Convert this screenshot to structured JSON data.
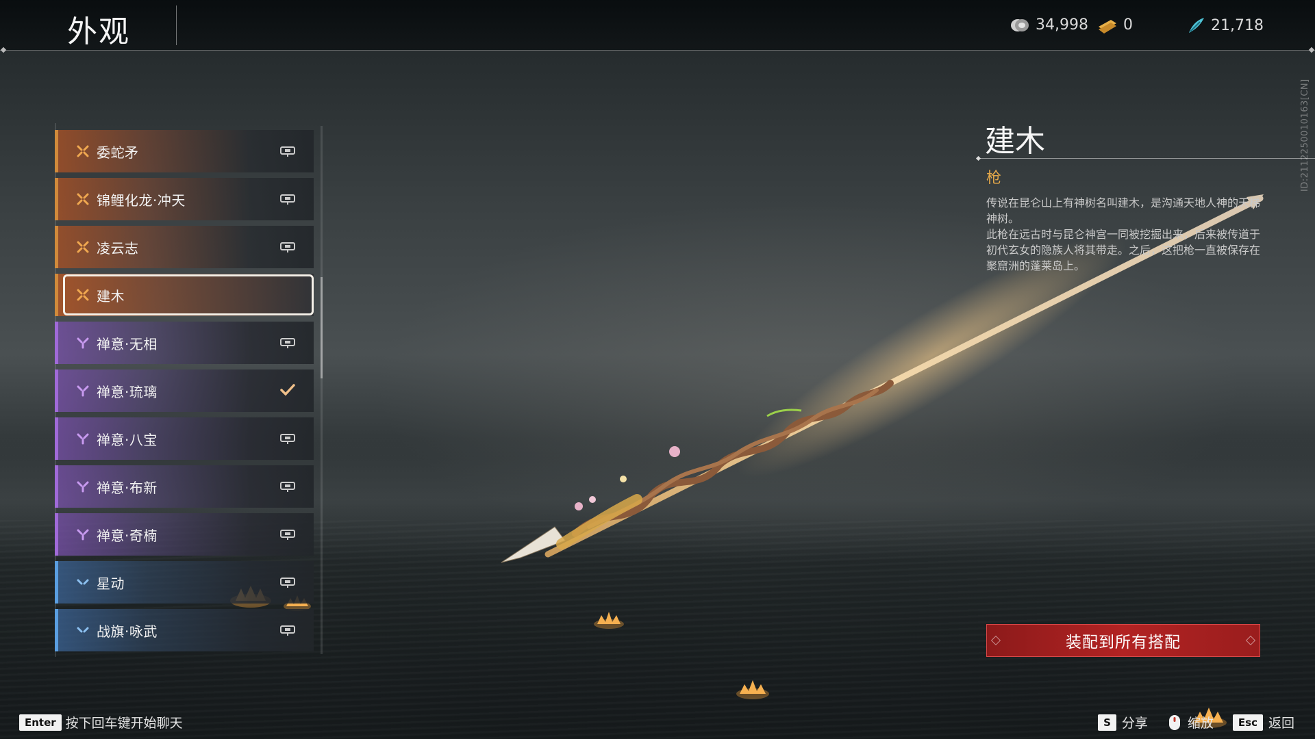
{
  "header": {
    "title": "外观",
    "currencies": [
      {
        "icon": "silver-coin-icon",
        "value": "34,998"
      },
      {
        "icon": "gold-ticket-icon",
        "value": "0"
      },
      {
        "icon": "jade-feather-icon",
        "value": "21,718"
      }
    ]
  },
  "side_id": "ID:2112250010163[CN]",
  "list": {
    "items": [
      {
        "label": "委蛇矛",
        "tier": "orange",
        "status": "locked"
      },
      {
        "label": "锦鲤化龙·冲天",
        "tier": "orange",
        "status": "locked"
      },
      {
        "label": "凌云志",
        "tier": "orange",
        "status": "locked"
      },
      {
        "label": "建木",
        "tier": "orange",
        "status": "selected"
      },
      {
        "label": "禅意·无相",
        "tier": "purple",
        "status": "locked"
      },
      {
        "label": "禅意·琉璃",
        "tier": "purple",
        "status": "equipped"
      },
      {
        "label": "禅意·八宝",
        "tier": "purple",
        "status": "locked"
      },
      {
        "label": "禅意·布新",
        "tier": "purple",
        "status": "locked"
      },
      {
        "label": "禅意·奇楠",
        "tier": "purple",
        "status": "locked"
      },
      {
        "label": "星动",
        "tier": "blue",
        "status": "locked"
      },
      {
        "label": "战旗·咏武",
        "tier": "blue",
        "status": "locked"
      }
    ]
  },
  "detail": {
    "title": "建木",
    "type": "枪",
    "description": [
      "传说在昆仑山上有神树名叫建木，是沟通天地人神的天梯神树。",
      "此枪在远古时与昆仑神宫一同被挖掘出来，后来被传道于初代玄女的隐族人将其带走。之后，这把枪一直被保存在聚窟洲的蓬莱岛上。"
    ],
    "equip_all_label": "装配到所有搭配"
  },
  "footer": {
    "chat_key": "Enter",
    "chat_hint": "按下回车键开始聊天",
    "actions": [
      {
        "key": "S",
        "label": "分享"
      },
      {
        "icon": "mouse-icon",
        "label": "缩放"
      },
      {
        "key": "Esc",
        "label": "返回"
      }
    ]
  },
  "colors": {
    "orange_tier": "#d08a3b",
    "purple_tier": "#a06ad8",
    "blue_tier": "#5a9ee0",
    "accent_gold": "#e3a84a",
    "equip_red": "#b22323"
  }
}
